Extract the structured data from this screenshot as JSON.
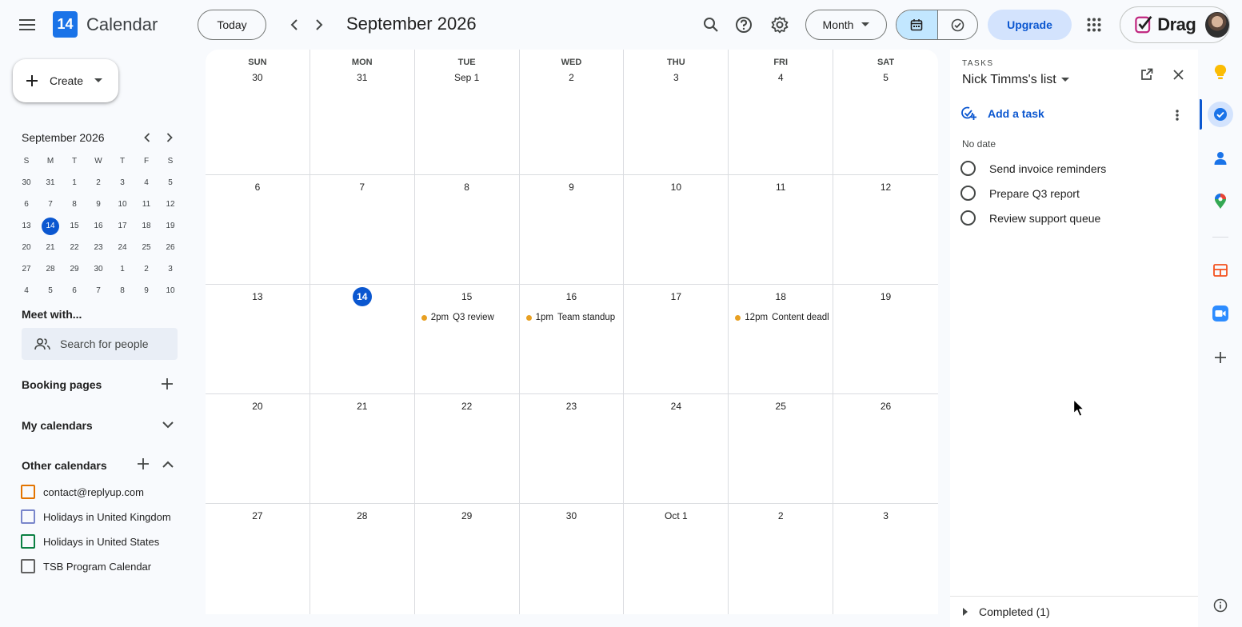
{
  "app": {
    "name": "Calendar",
    "logo_text": "14"
  },
  "header": {
    "today_label": "Today",
    "period": "September 2026",
    "view_label": "Month",
    "upgrade_label": "Upgrade",
    "account_label": "Drag"
  },
  "sidebar": {
    "create_label": "Create",
    "mini_title": "September 2026",
    "weekday_initials": [
      "S",
      "M",
      "T",
      "W",
      "T",
      "F",
      "S"
    ],
    "mini_days": [
      "30",
      "31",
      "1",
      "2",
      "3",
      "4",
      "5",
      "6",
      "7",
      "8",
      "9",
      "10",
      "11",
      "12",
      "13",
      "14",
      "15",
      "16",
      "17",
      "18",
      "19",
      "20",
      "21",
      "22",
      "23",
      "24",
      "25",
      "26",
      "27",
      "28",
      "29",
      "30",
      "1",
      "2",
      "3",
      "4",
      "5",
      "6",
      "7",
      "8",
      "9",
      "10"
    ],
    "mini_today_index": 15,
    "meet_title": "Meet with...",
    "search_people_placeholder": "Search for people",
    "booking_title": "Booking pages",
    "my_calendars_title": "My calendars",
    "other_calendars_title": "Other calendars",
    "other_calendars": [
      {
        "label": "contact@replyup.com",
        "color": "#e37400"
      },
      {
        "label": "Holidays in United Kingdom",
        "color": "#7986cb"
      },
      {
        "label": "Holidays in United States",
        "color": "#0b8043"
      },
      {
        "label": "TSB Program Calendar",
        "color": "#616161"
      }
    ]
  },
  "month_view": {
    "weekdays": [
      "SUN",
      "MON",
      "TUE",
      "WED",
      "THU",
      "FRI",
      "SAT"
    ],
    "weeks": [
      [
        "30",
        "31",
        "Sep 1",
        "2",
        "3",
        "4",
        "5"
      ],
      [
        "6",
        "7",
        "8",
        "9",
        "10",
        "11",
        "12"
      ],
      [
        "13",
        "14",
        "15",
        "16",
        "17",
        "18",
        "19"
      ],
      [
        "20",
        "21",
        "22",
        "23",
        "24",
        "25",
        "26"
      ],
      [
        "27",
        "28",
        "29",
        "30",
        "Oct 1",
        "2",
        "3"
      ]
    ],
    "today": {
      "week": 2,
      "day": 1
    },
    "event_color": "#e8a022",
    "events": [
      {
        "week": 2,
        "day": 2,
        "time": "2pm",
        "title": "Q3 review"
      },
      {
        "week": 2,
        "day": 3,
        "time": "1pm",
        "title": "Team standup"
      },
      {
        "week": 2,
        "day": 5,
        "time": "12pm",
        "title": "Content deadline"
      }
    ]
  },
  "tasks_panel": {
    "section_label": "TASKS",
    "list_name": "Nick Timms's list",
    "add_task_label": "Add a task",
    "no_date_label": "No date",
    "tasks": [
      "Send invoice reminders",
      "Prepare Q3 report",
      "Review support queue"
    ],
    "completed_label": "Completed (1)"
  },
  "accent_color": "#0b57d0"
}
